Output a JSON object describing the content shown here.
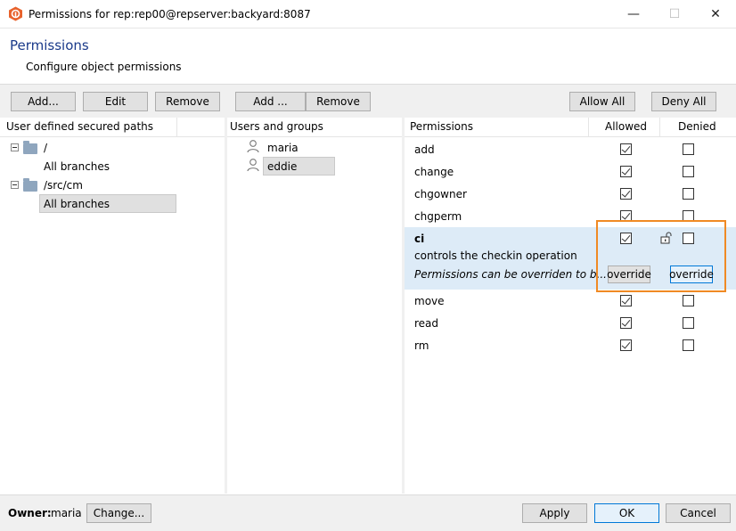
{
  "window": {
    "title": "Permissions for rep:rep00@repserver:backyard:8087",
    "app_icon": "plastic-scm-logo-icon",
    "controls": {
      "minimize": "—",
      "maximize": "☐",
      "close": "✕"
    }
  },
  "header": {
    "title": "Permissions",
    "subtitle": "Configure object permissions"
  },
  "paths_panel": {
    "buttons": {
      "add": "Add...",
      "edit": "Edit",
      "remove": "Remove"
    },
    "column_header": "User defined secured paths",
    "tree": [
      {
        "path": "/",
        "branch": "All branches",
        "selected": false
      },
      {
        "path": "/src/cm",
        "branch": "All branches",
        "selected": true
      }
    ]
  },
  "users_panel": {
    "buttons": {
      "add": "Add ...",
      "remove": "Remove"
    },
    "column_header": "Users and groups",
    "users": [
      {
        "name": "maria",
        "selected": false
      },
      {
        "name": "eddie",
        "selected": true
      }
    ]
  },
  "permissions_panel": {
    "buttons": {
      "allow_all": "Allow All",
      "deny_all": "Deny All"
    },
    "columns": {
      "permissions": "Permissions",
      "allowed": "Allowed",
      "denied": "Denied"
    },
    "rows_top": [
      {
        "name": "add",
        "allowed": true,
        "denied": false
      },
      {
        "name": "change",
        "allowed": true,
        "denied": false
      },
      {
        "name": "chgowner",
        "allowed": true,
        "denied": false
      },
      {
        "name": "chgperm",
        "allowed": true,
        "denied": false
      }
    ],
    "selected_row": {
      "name": "ci",
      "description": "controls the checkin operation",
      "note": "Permissions can be overriden to b...",
      "allowed": true,
      "denied": false,
      "lock_icon": "unlock-icon",
      "override_allowed_label": "override",
      "override_denied_label": "override"
    },
    "rows_bottom": [
      {
        "name": "move",
        "allowed": true,
        "denied": false
      },
      {
        "name": "read",
        "allowed": true,
        "denied": false
      },
      {
        "name": "rm",
        "allowed": true,
        "denied": false
      }
    ]
  },
  "footer": {
    "owner_label": "Owner:",
    "owner_value": "maria",
    "change_button": "Change...",
    "apply_button": "Apply",
    "ok_button": "OK",
    "cancel_button": "Cancel"
  },
  "colors": {
    "accent": "#0078d7",
    "header_title": "#1a3a8a",
    "selection": "#ddebf7",
    "highlight_outline": "#f08a24"
  }
}
